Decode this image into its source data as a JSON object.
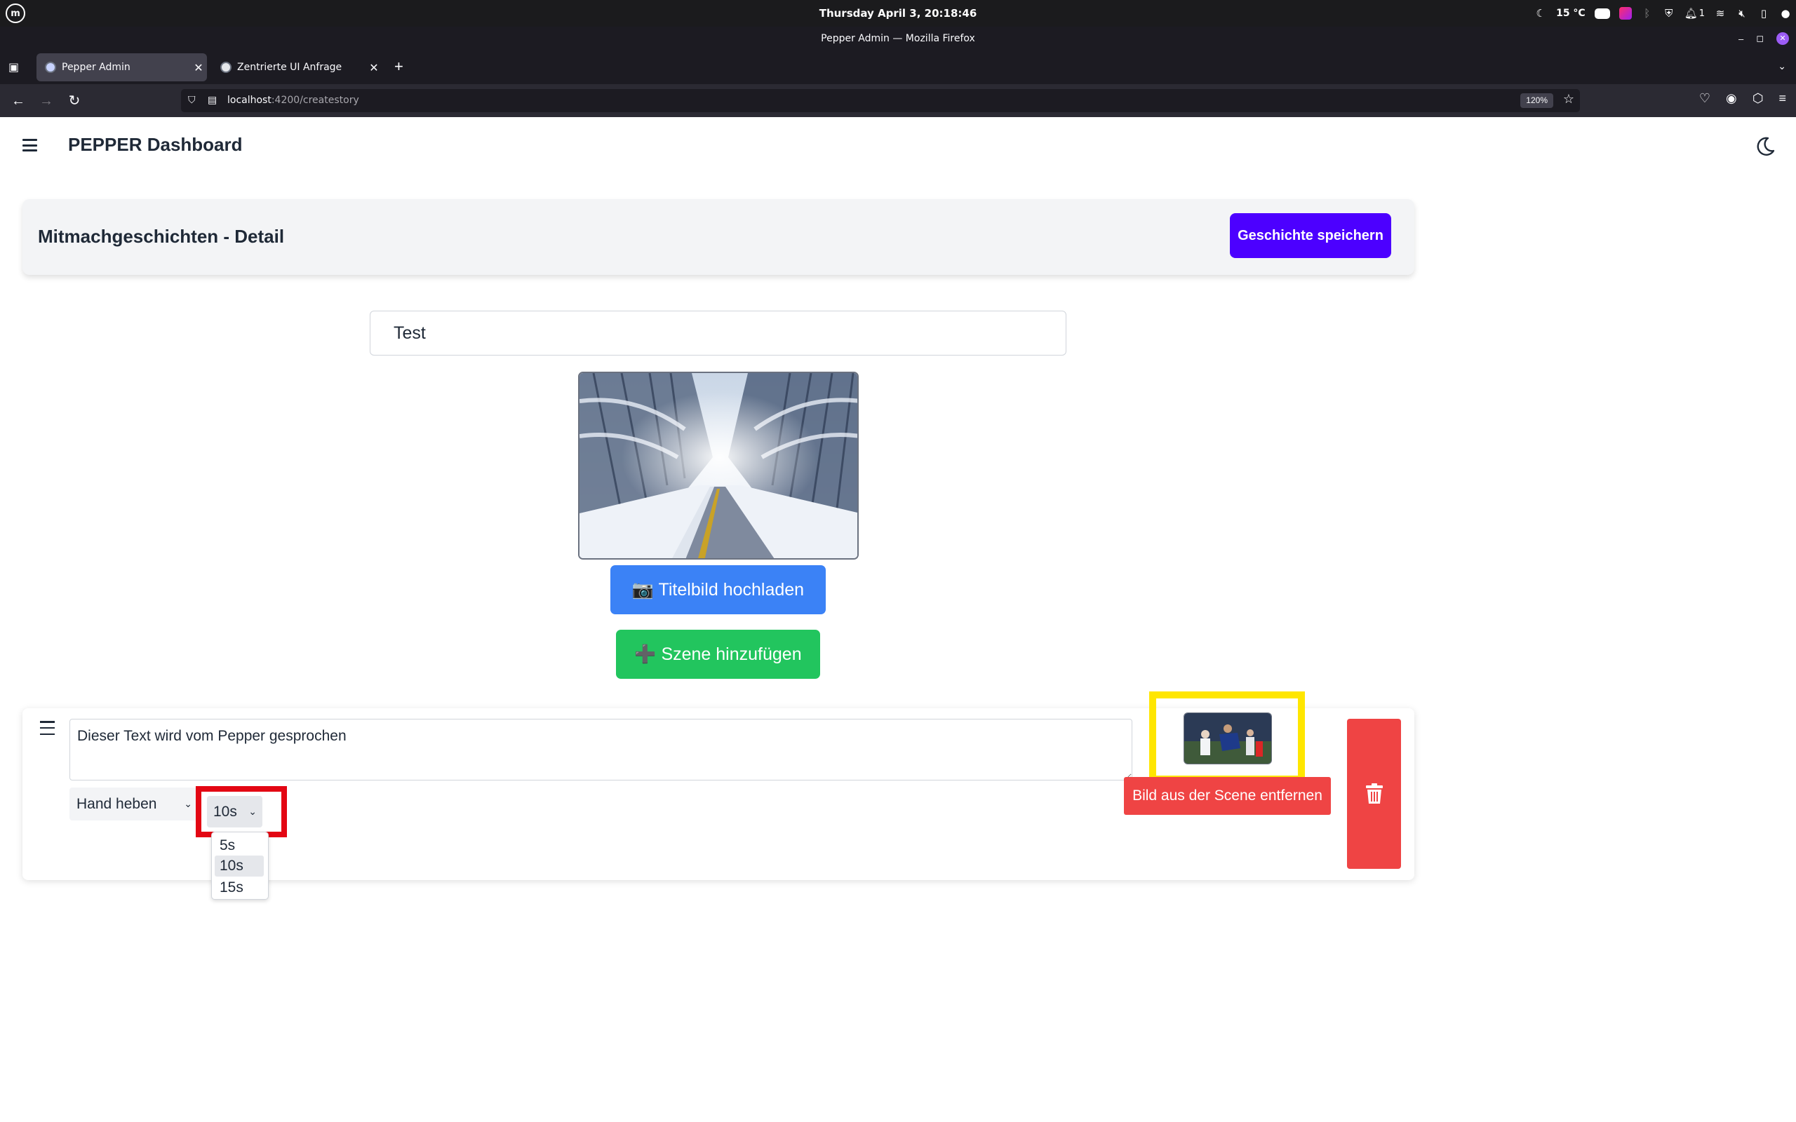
{
  "os": {
    "clock": "Thursday April 3, 20:18:46",
    "weather": "15 °C",
    "notification_count": "1"
  },
  "browser": {
    "window_title": "Pepper Admin — Mozilla Firefox",
    "tabs": [
      {
        "label": "Pepper Admin",
        "active": true
      },
      {
        "label": "Zentrierte UI Anfrage",
        "active": false
      }
    ],
    "url_host": "localhost",
    "url_path": ":4200/createstory",
    "zoom": "120%"
  },
  "header": {
    "title": "PEPPER Dashboard"
  },
  "detail": {
    "title": "Mitmachgeschichten - Detail",
    "save_label": "Geschichte speichern"
  },
  "story": {
    "title_value": "Test",
    "upload_label": "📷 Titelbild hochladen",
    "add_scene_label": "➕ Szene hinzufügen"
  },
  "scene": {
    "text": "Dieser Text wird vom Pepper gesprochen",
    "gesture": "Hand heben",
    "duration": "10s",
    "duration_options": [
      "5s",
      "10s",
      "15s"
    ],
    "remove_image_label": "Bild aus der Scene entfernen"
  },
  "colors": {
    "primary": "#4c00ff",
    "upload": "#3b82f6",
    "add": "#22c55e",
    "danger": "#ef4444",
    "highlight_red": "#e30613",
    "highlight_yellow": "#ffe600"
  }
}
